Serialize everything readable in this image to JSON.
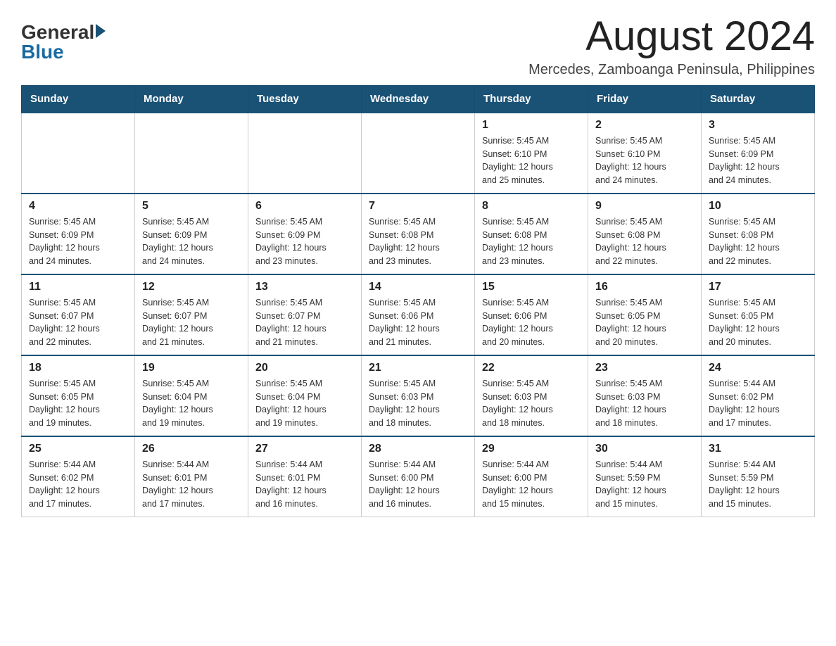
{
  "logo": {
    "general": "General",
    "blue": "Blue"
  },
  "title": "August 2024",
  "subtitle": "Mercedes, Zamboanga Peninsula, Philippines",
  "days_of_week": [
    "Sunday",
    "Monday",
    "Tuesday",
    "Wednesday",
    "Thursday",
    "Friday",
    "Saturday"
  ],
  "weeks": [
    [
      {
        "day": "",
        "info": ""
      },
      {
        "day": "",
        "info": ""
      },
      {
        "day": "",
        "info": ""
      },
      {
        "day": "",
        "info": ""
      },
      {
        "day": "1",
        "info": "Sunrise: 5:45 AM\nSunset: 6:10 PM\nDaylight: 12 hours\nand 25 minutes."
      },
      {
        "day": "2",
        "info": "Sunrise: 5:45 AM\nSunset: 6:10 PM\nDaylight: 12 hours\nand 24 minutes."
      },
      {
        "day": "3",
        "info": "Sunrise: 5:45 AM\nSunset: 6:09 PM\nDaylight: 12 hours\nand 24 minutes."
      }
    ],
    [
      {
        "day": "4",
        "info": "Sunrise: 5:45 AM\nSunset: 6:09 PM\nDaylight: 12 hours\nand 24 minutes."
      },
      {
        "day": "5",
        "info": "Sunrise: 5:45 AM\nSunset: 6:09 PM\nDaylight: 12 hours\nand 24 minutes."
      },
      {
        "day": "6",
        "info": "Sunrise: 5:45 AM\nSunset: 6:09 PM\nDaylight: 12 hours\nand 23 minutes."
      },
      {
        "day": "7",
        "info": "Sunrise: 5:45 AM\nSunset: 6:08 PM\nDaylight: 12 hours\nand 23 minutes."
      },
      {
        "day": "8",
        "info": "Sunrise: 5:45 AM\nSunset: 6:08 PM\nDaylight: 12 hours\nand 23 minutes."
      },
      {
        "day": "9",
        "info": "Sunrise: 5:45 AM\nSunset: 6:08 PM\nDaylight: 12 hours\nand 22 minutes."
      },
      {
        "day": "10",
        "info": "Sunrise: 5:45 AM\nSunset: 6:08 PM\nDaylight: 12 hours\nand 22 minutes."
      }
    ],
    [
      {
        "day": "11",
        "info": "Sunrise: 5:45 AM\nSunset: 6:07 PM\nDaylight: 12 hours\nand 22 minutes."
      },
      {
        "day": "12",
        "info": "Sunrise: 5:45 AM\nSunset: 6:07 PM\nDaylight: 12 hours\nand 21 minutes."
      },
      {
        "day": "13",
        "info": "Sunrise: 5:45 AM\nSunset: 6:07 PM\nDaylight: 12 hours\nand 21 minutes."
      },
      {
        "day": "14",
        "info": "Sunrise: 5:45 AM\nSunset: 6:06 PM\nDaylight: 12 hours\nand 21 minutes."
      },
      {
        "day": "15",
        "info": "Sunrise: 5:45 AM\nSunset: 6:06 PM\nDaylight: 12 hours\nand 20 minutes."
      },
      {
        "day": "16",
        "info": "Sunrise: 5:45 AM\nSunset: 6:05 PM\nDaylight: 12 hours\nand 20 minutes."
      },
      {
        "day": "17",
        "info": "Sunrise: 5:45 AM\nSunset: 6:05 PM\nDaylight: 12 hours\nand 20 minutes."
      }
    ],
    [
      {
        "day": "18",
        "info": "Sunrise: 5:45 AM\nSunset: 6:05 PM\nDaylight: 12 hours\nand 19 minutes."
      },
      {
        "day": "19",
        "info": "Sunrise: 5:45 AM\nSunset: 6:04 PM\nDaylight: 12 hours\nand 19 minutes."
      },
      {
        "day": "20",
        "info": "Sunrise: 5:45 AM\nSunset: 6:04 PM\nDaylight: 12 hours\nand 19 minutes."
      },
      {
        "day": "21",
        "info": "Sunrise: 5:45 AM\nSunset: 6:03 PM\nDaylight: 12 hours\nand 18 minutes."
      },
      {
        "day": "22",
        "info": "Sunrise: 5:45 AM\nSunset: 6:03 PM\nDaylight: 12 hours\nand 18 minutes."
      },
      {
        "day": "23",
        "info": "Sunrise: 5:45 AM\nSunset: 6:03 PM\nDaylight: 12 hours\nand 18 minutes."
      },
      {
        "day": "24",
        "info": "Sunrise: 5:44 AM\nSunset: 6:02 PM\nDaylight: 12 hours\nand 17 minutes."
      }
    ],
    [
      {
        "day": "25",
        "info": "Sunrise: 5:44 AM\nSunset: 6:02 PM\nDaylight: 12 hours\nand 17 minutes."
      },
      {
        "day": "26",
        "info": "Sunrise: 5:44 AM\nSunset: 6:01 PM\nDaylight: 12 hours\nand 17 minutes."
      },
      {
        "day": "27",
        "info": "Sunrise: 5:44 AM\nSunset: 6:01 PM\nDaylight: 12 hours\nand 16 minutes."
      },
      {
        "day": "28",
        "info": "Sunrise: 5:44 AM\nSunset: 6:00 PM\nDaylight: 12 hours\nand 16 minutes."
      },
      {
        "day": "29",
        "info": "Sunrise: 5:44 AM\nSunset: 6:00 PM\nDaylight: 12 hours\nand 15 minutes."
      },
      {
        "day": "30",
        "info": "Sunrise: 5:44 AM\nSunset: 5:59 PM\nDaylight: 12 hours\nand 15 minutes."
      },
      {
        "day": "31",
        "info": "Sunrise: 5:44 AM\nSunset: 5:59 PM\nDaylight: 12 hours\nand 15 minutes."
      }
    ]
  ]
}
